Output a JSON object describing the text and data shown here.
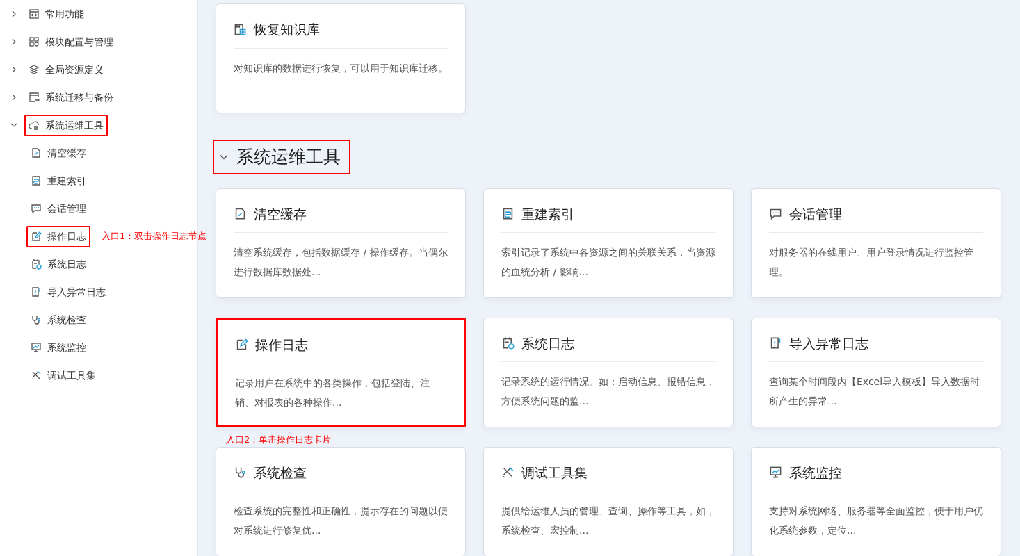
{
  "sidebar": {
    "items": [
      {
        "label": "常用功能",
        "expanded": false,
        "highlighted": false
      },
      {
        "label": "模块配置与管理",
        "expanded": false,
        "highlighted": false
      },
      {
        "label": "全局资源定义",
        "expanded": false,
        "highlighted": false
      },
      {
        "label": "系统迁移与备份",
        "expanded": false,
        "highlighted": false
      },
      {
        "label": "系统运维工具",
        "expanded": true,
        "highlighted": true,
        "children": [
          {
            "label": "清空缓存",
            "highlighted": false
          },
          {
            "label": "重建索引",
            "highlighted": false
          },
          {
            "label": "会话管理",
            "highlighted": false
          },
          {
            "label": "操作日志",
            "highlighted": true,
            "annotation": "入口1：双击操作日志节点"
          },
          {
            "label": "系统日志",
            "highlighted": false
          },
          {
            "label": "导入异常日志",
            "highlighted": false
          },
          {
            "label": "系统检查",
            "highlighted": false
          },
          {
            "label": "系统监控",
            "highlighted": false
          },
          {
            "label": "调试工具集",
            "highlighted": false
          }
        ]
      }
    ]
  },
  "main": {
    "top_cards": [
      {
        "title": "恢复知识库",
        "description": "对知识库的数据进行恢复，可以用于知识库迁移。",
        "highlighted": false
      }
    ],
    "section": {
      "title": "系统运维工具",
      "expanded": true,
      "highlighted": true
    },
    "cards": [
      {
        "title": "清空缓存",
        "description": "清空系统缓存，包括数据缓存 / 操作缓存。当偶尔进行数据库数据处...",
        "highlighted": false
      },
      {
        "title": "重建索引",
        "description": "索引记录了系统中各资源之间的关联关系，当资源的血统分析 / 影响...",
        "highlighted": false
      },
      {
        "title": "会话管理",
        "description": "对服务器的在线用户、用户登录情况进行监控管理。",
        "highlighted": false
      },
      {
        "title": "操作日志",
        "description": "记录用户在系统中的各类操作，包括登陆、注销、对报表的各种操作...",
        "highlighted": true,
        "annotation": "入口2：单击操作日志卡片"
      },
      {
        "title": "系统日志",
        "description": "记录系统的运行情况。如：启动信息、报错信息，方便系统问题的监...",
        "highlighted": false
      },
      {
        "title": "导入异常日志",
        "description": "查询某个时间段内【Excel导入模板】导入数据时所产生的异常...",
        "highlighted": false
      },
      {
        "title": "系统检查",
        "description": "检查系统的完整性和正确性，提示存在的问题以便对系统进行修复优...",
        "highlighted": false
      },
      {
        "title": "调试工具集",
        "description": "提供给运维人员的管理、查询、操作等工具，如，系统检查、宏控制...",
        "highlighted": false
      },
      {
        "title": "系统监控",
        "description": "支持对系统网络、服务器等全面监控，便于用户优化系统参数，定位...",
        "highlighted": false
      }
    ]
  }
}
